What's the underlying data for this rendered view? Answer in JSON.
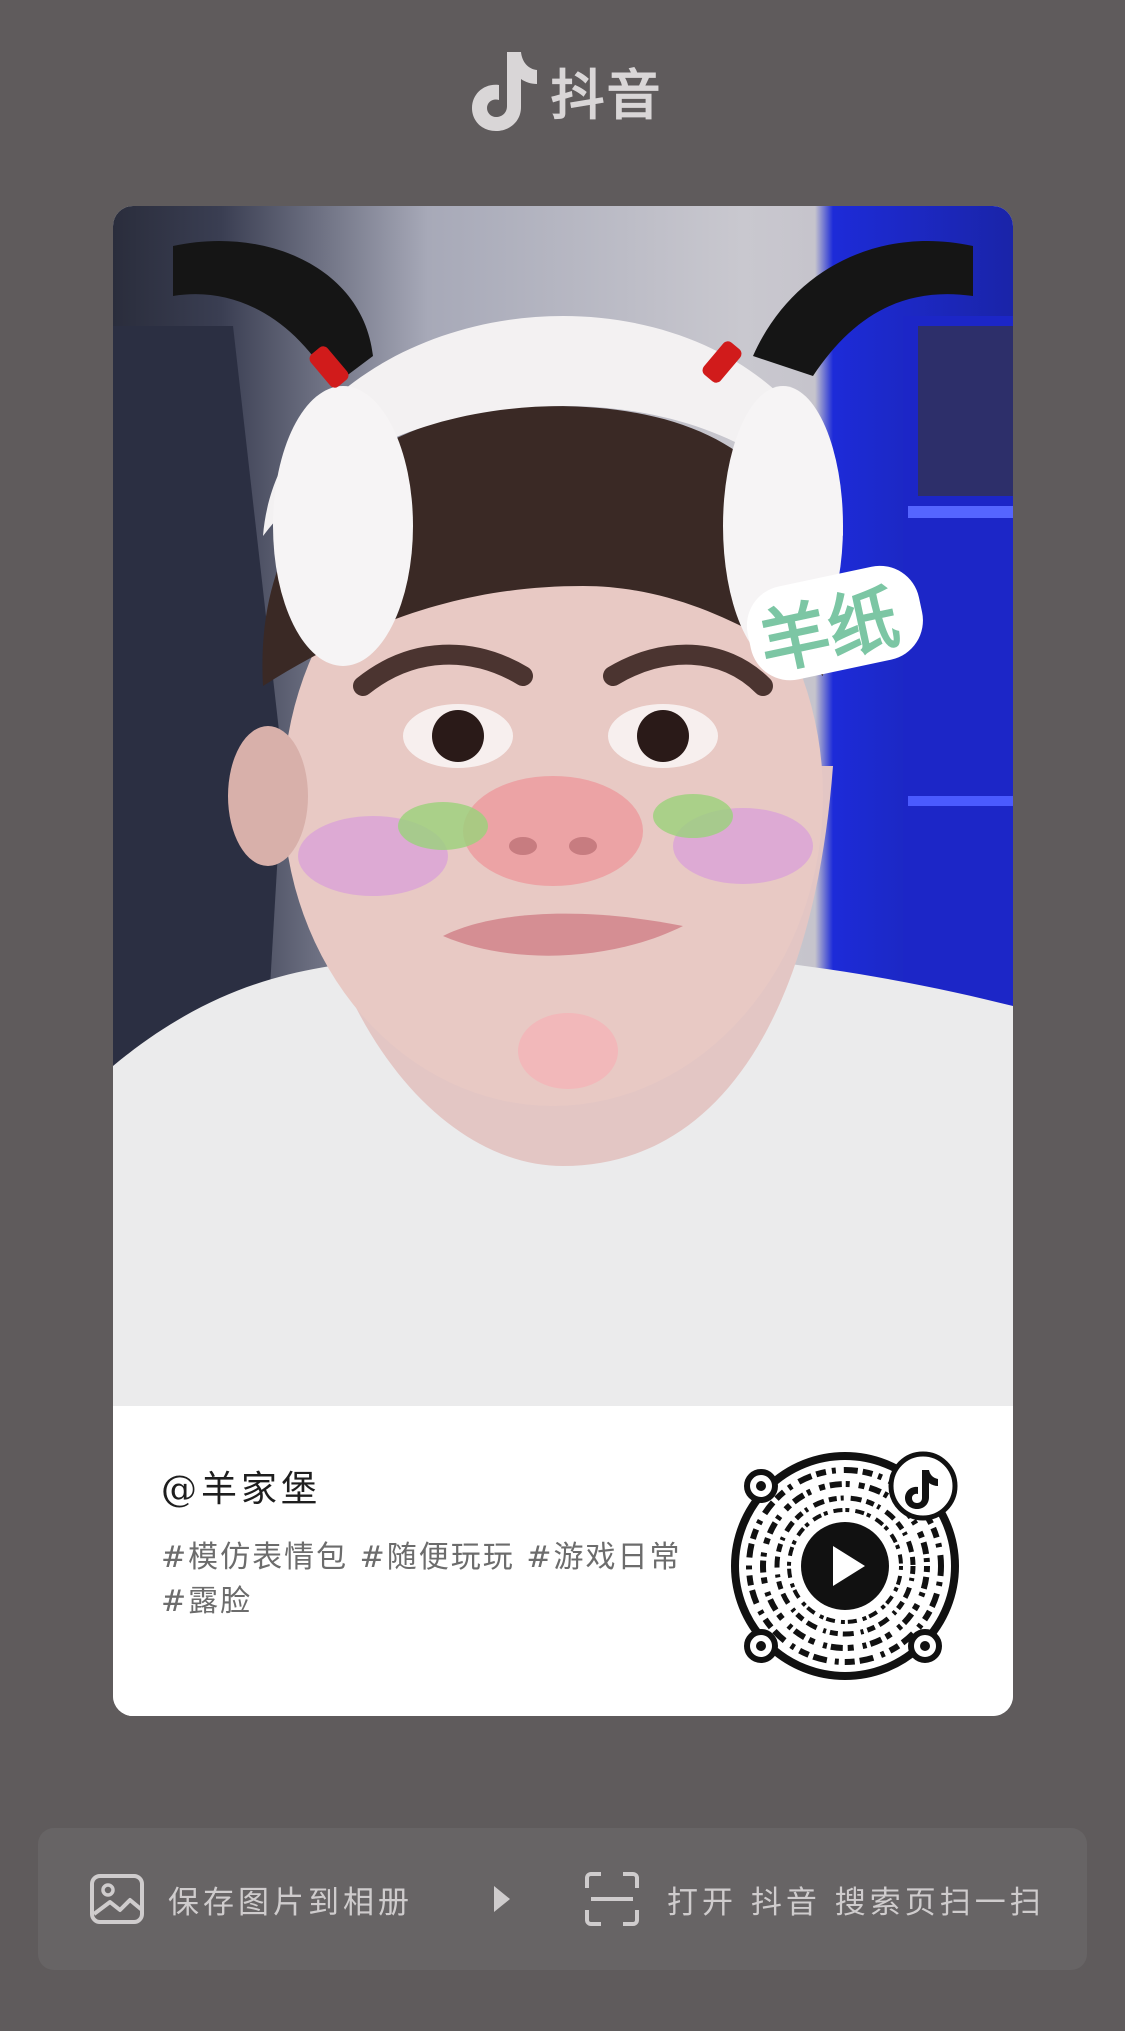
{
  "header": {
    "brand": "抖音",
    "logo_icon": "tiktok-note-icon"
  },
  "card": {
    "photo": {
      "sticker_text": "羊纸"
    },
    "username": "@羊家堡",
    "tags": "#模仿表情包 #随便玩玩 #游戏日常 #露脸",
    "qr_icon": "qr-code-with-play-icon"
  },
  "actions": {
    "save_label": "保存图片到相册",
    "save_icon": "image-icon",
    "arrow_icon": "play-triangle-icon",
    "scan_label": "打开 抖音 搜索页扫一扫",
    "scan_icon": "scan-frame-icon"
  },
  "colors": {
    "background": "#5f5b5c",
    "card_bg": "#ffffff",
    "bar_bg": "#676465",
    "sticker_green": "#7cc6a4"
  }
}
